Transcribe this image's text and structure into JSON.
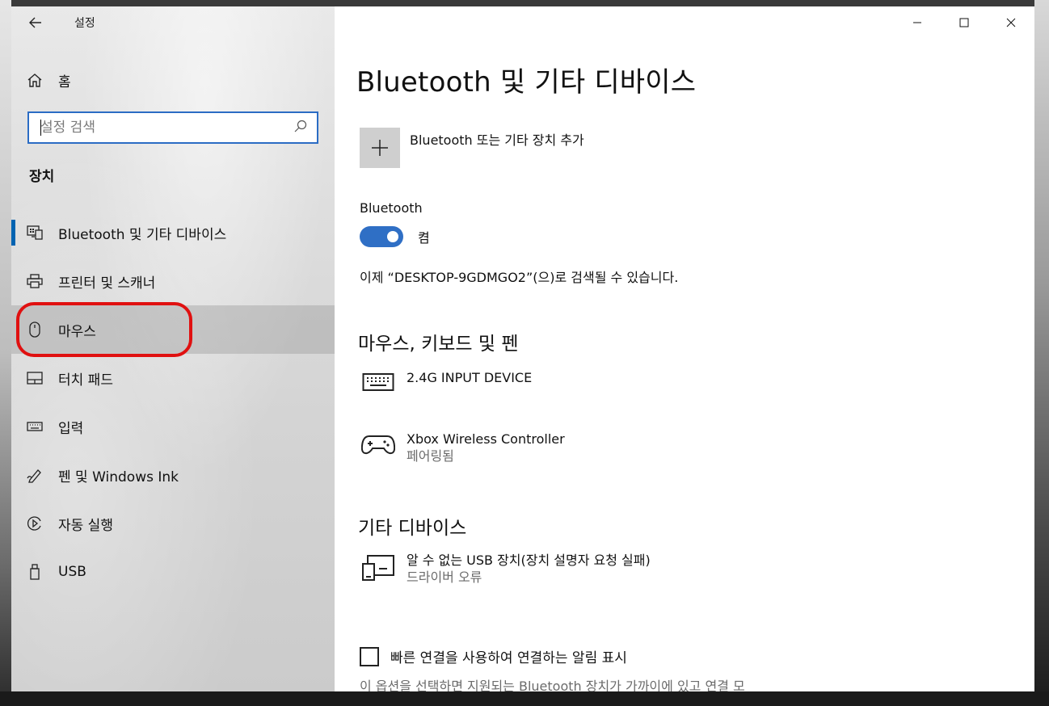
{
  "app": {
    "title": "설정",
    "back_icon": "back-arrow-icon"
  },
  "sidebar": {
    "home_label": "홈",
    "search_placeholder": "설정 검색",
    "section_title": "장치",
    "items": [
      {
        "label": "Bluetooth 및 기타 디바이스",
        "icon": "bluetooth-devices-icon",
        "selected": true
      },
      {
        "label": "프린터 및 스캐너",
        "icon": "printer-icon"
      },
      {
        "label": "마우스",
        "icon": "mouse-icon",
        "hovered": true
      },
      {
        "label": "터치 패드",
        "icon": "touchpad-icon"
      },
      {
        "label": "입력",
        "icon": "keyboard-icon"
      },
      {
        "label": "펜 및 Windows Ink",
        "icon": "pen-icon"
      },
      {
        "label": "자동 실행",
        "icon": "autoplay-icon"
      },
      {
        "label": "USB",
        "icon": "usb-icon"
      }
    ]
  },
  "main": {
    "page_title": "Bluetooth 및 기타 디바이스",
    "add_device_label": "Bluetooth 또는 기타 장치 추가",
    "bluetooth_label": "Bluetooth",
    "bluetooth_state": "켬",
    "discoverable_text": "이제 “DESKTOP-9GDMGO2”(으)로 검색될 수 있습니다.",
    "mouse_keyboard_pen": {
      "title": "마우스, 키보드 및 펜",
      "devices": [
        {
          "name": "2.4G INPUT DEVICE",
          "status": "",
          "icon": "keyboard-icon"
        },
        {
          "name": "Xbox Wireless Controller",
          "status": "페어링됨",
          "icon": "gamepad-icon"
        }
      ]
    },
    "other_devices": {
      "title": "기타 디바이스",
      "devices": [
        {
          "name": "알 수 없는 USB 장치(장치 설명자 요청 실패)",
          "status": "드라이버 오류",
          "icon": "unknown-device-icon"
        }
      ]
    },
    "swift_pair_label": "빠른 연결을 사용하여 연결하는 알림 표시",
    "swift_pair_desc": "이 옵션을 선택하면 지원되는 Bluetooth 장치가 가까이에 있고 연결 모"
  },
  "colors": {
    "accent": "#0063b1",
    "toggle_on": "#2f6fc5",
    "search_border": "#2b6cc4",
    "annotation": "#e01010"
  }
}
